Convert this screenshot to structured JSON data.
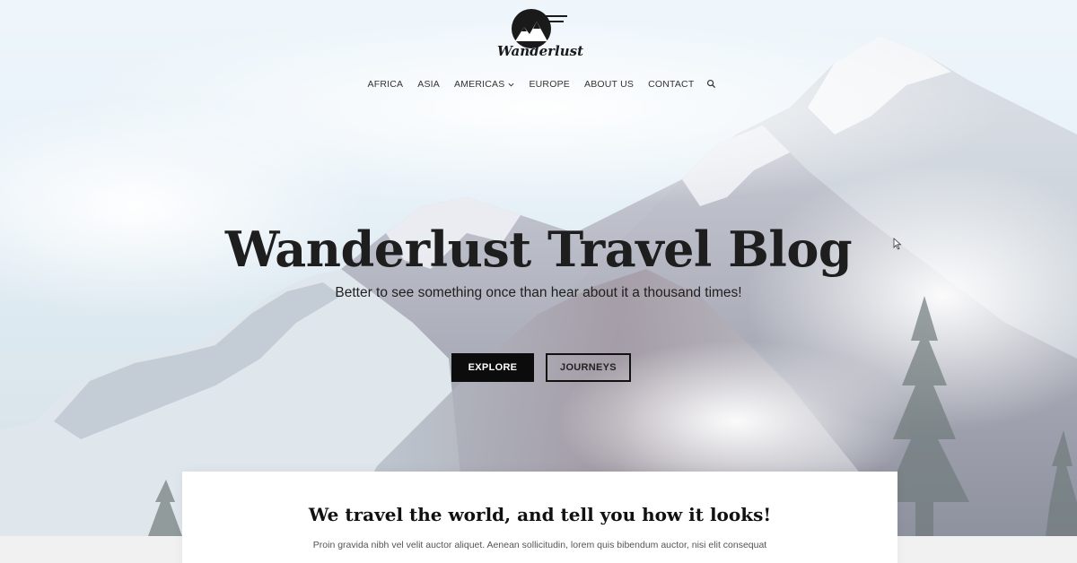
{
  "logo": {
    "text": "Wanderlust"
  },
  "nav": {
    "items": [
      {
        "label": "AFRICA"
      },
      {
        "label": "ASIA"
      },
      {
        "label": "AMERICAS",
        "has_dropdown": true
      },
      {
        "label": "EUROPE"
      },
      {
        "label": "ABOUT US"
      },
      {
        "label": "CONTACT"
      }
    ],
    "search_icon": "search-icon"
  },
  "hero": {
    "title": "Wanderlust Travel Blog",
    "subtitle": "Better to see something once than hear about it a thousand times!",
    "buttons": {
      "explore": "EXPLORE",
      "journeys": "JOURNEYS"
    }
  },
  "intro": {
    "title": "We travel the world, and tell you how it looks!",
    "text": "Proin gravida nibh vel velit auctor aliquet. Aenean sollicitudin, lorem quis bibendum auctor, nisi elit consequat"
  },
  "colors": {
    "primary_button": "#0c0c0c",
    "text_dark": "#1e1e1e",
    "card_bg": "#ffffff",
    "footer_strip": "#f1f1f1"
  }
}
